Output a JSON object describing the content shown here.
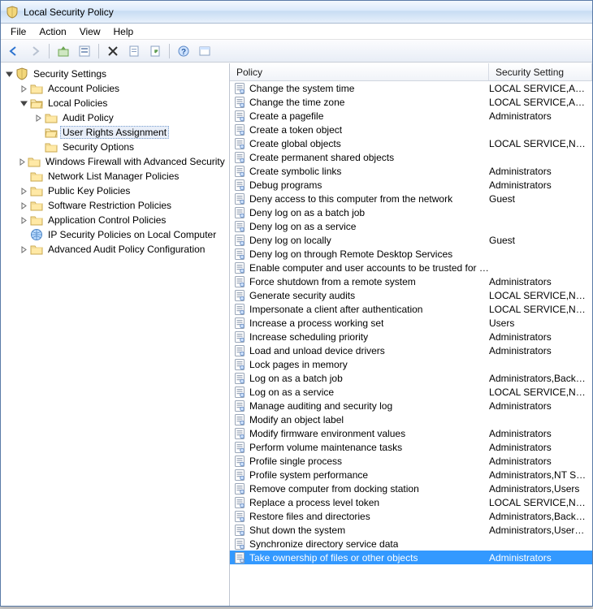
{
  "window": {
    "title": "Local Security Policy"
  },
  "menu": {
    "file": "File",
    "action": "Action",
    "view": "View",
    "help": "Help"
  },
  "tree": {
    "root": "Security Settings",
    "account_policies": "Account Policies",
    "local_policies": "Local Policies",
    "audit_policy": "Audit Policy",
    "user_rights": "User Rights Assignment",
    "security_options": "Security Options",
    "firewall": "Windows Firewall with Advanced Security",
    "nlmp": "Network List Manager Policies",
    "pubkey": "Public Key Policies",
    "srp": "Software Restriction Policies",
    "acp": "Application Control Policies",
    "ipsec": "IP Security Policies on Local Computer",
    "aapc": "Advanced Audit Policy Configuration"
  },
  "columns": {
    "policy": "Policy",
    "setting": "Security Setting"
  },
  "policies": [
    {
      "name": "Change the system time",
      "setting": "LOCAL SERVICE,Admini..."
    },
    {
      "name": "Change the time zone",
      "setting": "LOCAL SERVICE,Admini..."
    },
    {
      "name": "Create a pagefile",
      "setting": "Administrators"
    },
    {
      "name": "Create a token object",
      "setting": ""
    },
    {
      "name": "Create global objects",
      "setting": "LOCAL SERVICE,NETWO..."
    },
    {
      "name": "Create permanent shared objects",
      "setting": ""
    },
    {
      "name": "Create symbolic links",
      "setting": "Administrators"
    },
    {
      "name": "Debug programs",
      "setting": "Administrators"
    },
    {
      "name": "Deny access to this computer from the network",
      "setting": "Guest"
    },
    {
      "name": "Deny log on as a batch job",
      "setting": ""
    },
    {
      "name": "Deny log on as a service",
      "setting": ""
    },
    {
      "name": "Deny log on locally",
      "setting": "Guest"
    },
    {
      "name": "Deny log on through Remote Desktop Services",
      "setting": ""
    },
    {
      "name": "Enable computer and user accounts to be trusted for delega...",
      "setting": ""
    },
    {
      "name": "Force shutdown from a remote system",
      "setting": "Administrators"
    },
    {
      "name": "Generate security audits",
      "setting": "LOCAL SERVICE,NETWO..."
    },
    {
      "name": "Impersonate a client after authentication",
      "setting": "LOCAL SERVICE,NETWO..."
    },
    {
      "name": "Increase a process working set",
      "setting": "Users"
    },
    {
      "name": "Increase scheduling priority",
      "setting": "Administrators"
    },
    {
      "name": "Load and unload device drivers",
      "setting": "Administrators"
    },
    {
      "name": "Lock pages in memory",
      "setting": ""
    },
    {
      "name": "Log on as a batch job",
      "setting": "Administrators,Backup ..."
    },
    {
      "name": "Log on as a service",
      "setting": "LOCAL SERVICE,NETWO..."
    },
    {
      "name": "Manage auditing and security log",
      "setting": "Administrators"
    },
    {
      "name": "Modify an object label",
      "setting": ""
    },
    {
      "name": "Modify firmware environment values",
      "setting": "Administrators"
    },
    {
      "name": "Perform volume maintenance tasks",
      "setting": "Administrators"
    },
    {
      "name": "Profile single process",
      "setting": "Administrators"
    },
    {
      "name": "Profile system performance",
      "setting": "Administrators,NT SERVI..."
    },
    {
      "name": "Remove computer from docking station",
      "setting": "Administrators,Users"
    },
    {
      "name": "Replace a process level token",
      "setting": "LOCAL SERVICE,NETWO..."
    },
    {
      "name": "Restore files and directories",
      "setting": "Administrators,Backup ..."
    },
    {
      "name": "Shut down the system",
      "setting": "Administrators,Users,Ba..."
    },
    {
      "name": "Synchronize directory service data",
      "setting": ""
    },
    {
      "name": "Take ownership of files or other objects",
      "setting": "Administrators",
      "selected": true
    }
  ]
}
